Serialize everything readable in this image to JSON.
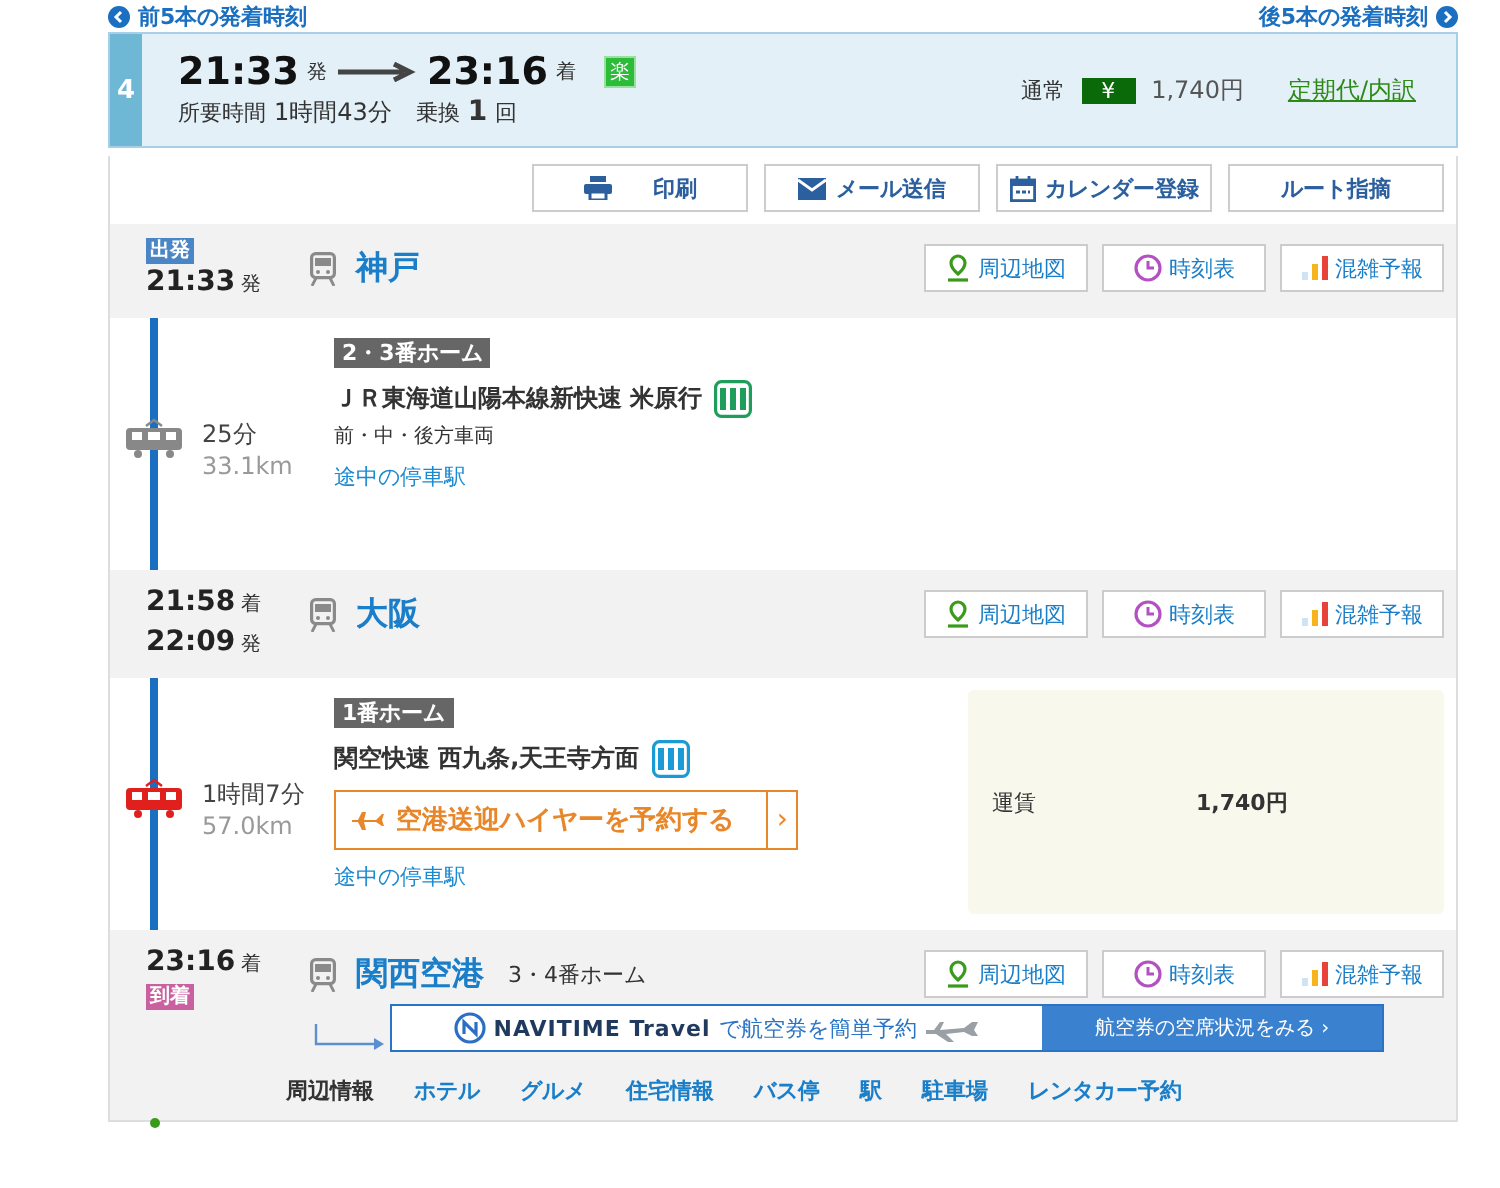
{
  "nav": {
    "prev": "前5本の発着時刻",
    "next": "後5本の発着時刻"
  },
  "summary": {
    "number": "4",
    "depart": "21:33",
    "depart_suffix": "発",
    "arrive": "23:16",
    "arrive_suffix": "着",
    "badge": "楽",
    "duration_label": "所要時間",
    "duration": "1時間43分",
    "transfer_label": "乗換",
    "transfers": "1",
    "transfer_unit": "回",
    "fare_type": "通常",
    "fare_icon": "¥",
    "fare": "1,740円",
    "pass_link": "定期代/内訳"
  },
  "actions": [
    {
      "kind": "print",
      "label": "印刷"
    },
    {
      "kind": "mail",
      "label": "メール送信"
    },
    {
      "kind": "calendar",
      "label": "カレンダー登録"
    },
    {
      "kind": "report",
      "label": "ルート指摘"
    }
  ],
  "route": [
    {
      "kind": "origin",
      "tag": {
        "label": "出発",
        "color": "#4a86c5"
      },
      "times": [
        {
          "time": "21:33",
          "suffix": "発"
        }
      ],
      "name": "神戸",
      "links": [
        {
          "kind": "map",
          "label": "周辺地図"
        },
        {
          "kind": "timetable",
          "label": "時刻表"
        },
        {
          "kind": "congestion",
          "label": "混雑予報"
        }
      ]
    },
    {
      "kind": "segment",
      "color": "#888888",
      "platform": "2・3番ホーム",
      "duration": "25分",
      "distance": "33.1km",
      "train": "ＪＲ東海道山陽本線新快速 米原行",
      "car_icon": {
        "color": "#1e9e5a"
      },
      "cars": "前・中・後方車両",
      "stops_link": "途中の停車駅"
    },
    {
      "kind": "station",
      "times": [
        {
          "time": "21:58",
          "suffix": "着"
        },
        {
          "time": "22:09",
          "suffix": "発"
        }
      ],
      "name": "大阪",
      "links": [
        {
          "kind": "map",
          "label": "周辺地図"
        },
        {
          "kind": "timetable",
          "label": "時刻表"
        },
        {
          "kind": "congestion",
          "label": "混雑予報"
        }
      ]
    },
    {
      "kind": "segment",
      "color": "#e0201c",
      "platform": "1番ホーム",
      "duration": "1時間7分",
      "distance": "57.0km",
      "train": "関空快速 西九条,天王寺方面",
      "car_icon": {
        "color": "#1a9ad6"
      },
      "promo": {
        "label": "空港送迎ハイヤーを予約する",
        "arrow": "›"
      },
      "stops_link": "途中の停車駅",
      "fare": {
        "label": "運賃",
        "value": "1,740円"
      }
    },
    {
      "kind": "destination",
      "tag": {
        "label": "到着",
        "color": "#c9609f"
      },
      "times": [
        {
          "time": "23:16",
          "suffix": "着"
        }
      ],
      "name": "関西空港",
      "platform": "3・4番ホーム",
      "links": [
        {
          "kind": "map",
          "label": "周辺地図"
        },
        {
          "kind": "timetable",
          "label": "時刻表"
        },
        {
          "kind": "congestion",
          "label": "混雑予報"
        }
      ],
      "travel": {
        "brand": "NAVITIME Travel",
        "text": "で航空券を簡単予約",
        "button": "航空券の空席状況をみる ›"
      },
      "nearby": {
        "label": "周辺情報",
        "links": [
          "ホテル",
          "グルメ",
          "住宅情報",
          "バス停",
          "駅",
          "駐車場",
          "レンタカー予約"
        ]
      }
    }
  ]
}
